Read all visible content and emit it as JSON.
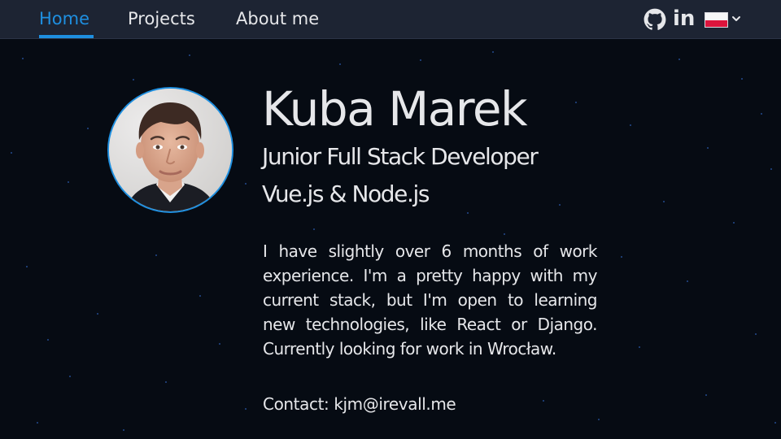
{
  "nav": {
    "items": [
      {
        "label": "Home",
        "active": true
      },
      {
        "label": "Projects",
        "active": false
      },
      {
        "label": "About me",
        "active": false
      }
    ],
    "social": {
      "github_icon": "github-icon",
      "linkedin_label": "in"
    },
    "language": {
      "flag": "poland-flag",
      "chevron": "chevron-down-icon"
    }
  },
  "profile": {
    "name": "Kuba Marek",
    "role": "Junior Full Stack Developer",
    "stack": "Vue.js & Node.js",
    "bio": "I have slightly over 6 months of work experience. I'm a pretty happy with my current stack, but I'm open to learning new technologies, like React or Django. Currently looking for work in Wrocław.",
    "contact_label": "Contact: ",
    "contact_email": "kjm@irevall.me"
  },
  "colors": {
    "accent": "#1e8fe0",
    "nav_bg": "#1d2433",
    "page_bg": "#060b13",
    "text": "#e6e7ea"
  }
}
